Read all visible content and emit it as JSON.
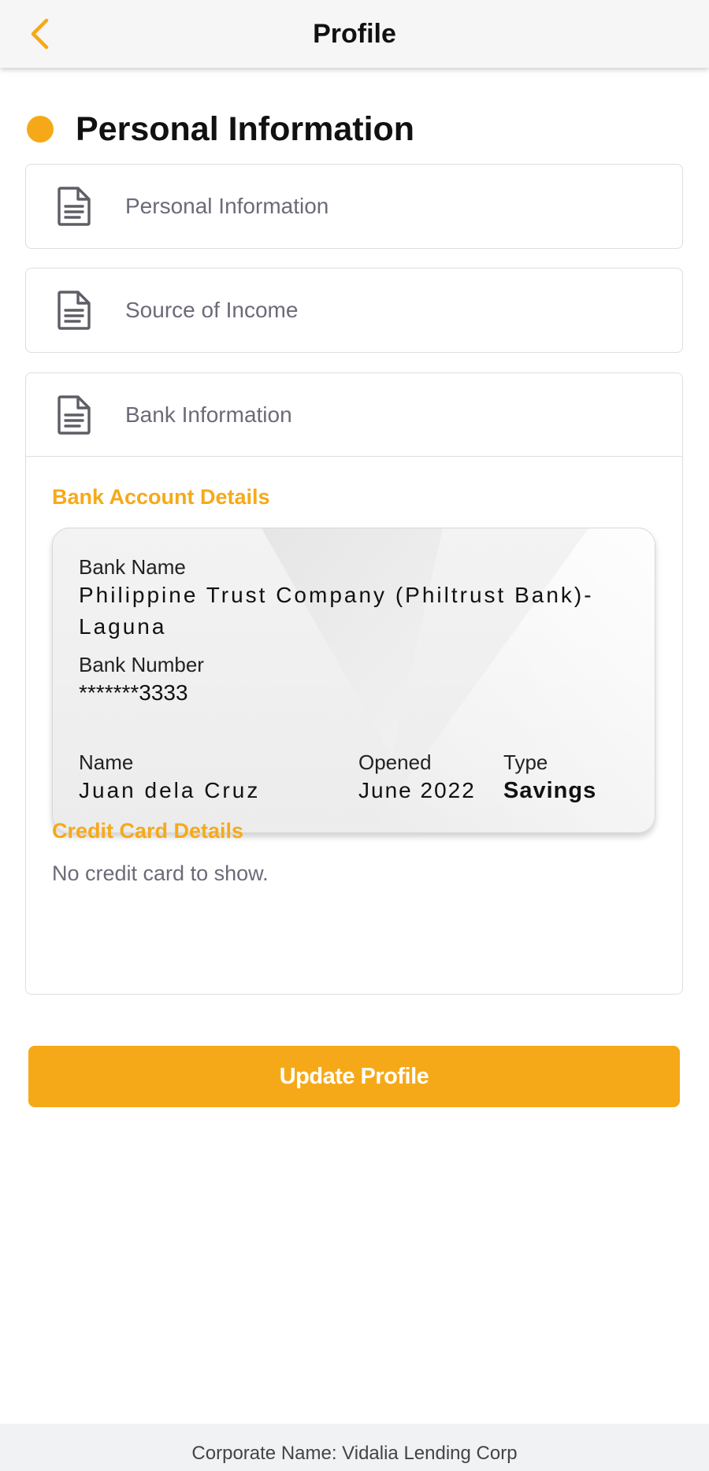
{
  "header": {
    "title": "Profile",
    "back_icon": "chevron-left-icon",
    "accent": "#f6a918"
  },
  "section": {
    "title": "Personal Information"
  },
  "accordion": {
    "items": [
      {
        "label": "Personal Information",
        "icon": "document-icon"
      },
      {
        "label": "Source of Income",
        "icon": "document-icon"
      },
      {
        "label": "Bank Information",
        "icon": "document-icon",
        "expanded": true
      }
    ]
  },
  "bank": {
    "heading": "Bank Account Details",
    "card": {
      "bank_name_label": "Bank Name",
      "bank_name_line1": "Philippine Trust Company (Philtrust Bank)-",
      "bank_name_line2": "Laguna",
      "bank_number_label": "Bank Number",
      "bank_number": "*******3333",
      "name_label": "Name",
      "name": "Juan dela Cruz",
      "opened_label": "Opened",
      "opened": "June 2022",
      "type_label": "Type",
      "type": "Savings"
    }
  },
  "credit": {
    "heading": "Credit Card Details",
    "empty_text": "No credit card to show."
  },
  "actions": {
    "update_label": "Update Profile"
  },
  "footer": {
    "text": "Corporate Name: Vidalia Lending Corp"
  }
}
